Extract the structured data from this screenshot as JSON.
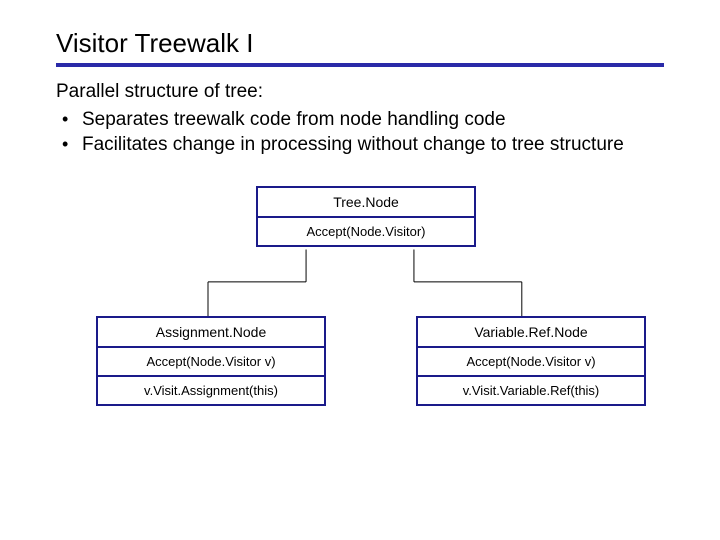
{
  "title": "Visitor Treewalk I",
  "intro": "Parallel structure of tree:",
  "bullets": [
    "Separates treewalk code from node handling code",
    "Facilitates change in processing without change to tree structure"
  ],
  "diagram": {
    "parent": {
      "name": "Tree.Node",
      "method": "Accept(Node.Visitor)"
    },
    "children": [
      {
        "name": "Assignment.Node",
        "method": "Accept(Node.Visitor v)",
        "body": "v.Visit.Assignment(this)"
      },
      {
        "name": "Variable.Ref.Node",
        "method": "Accept(Node.Visitor v)",
        "body": "v.Visit.Variable.Ref(this)"
      }
    ]
  }
}
